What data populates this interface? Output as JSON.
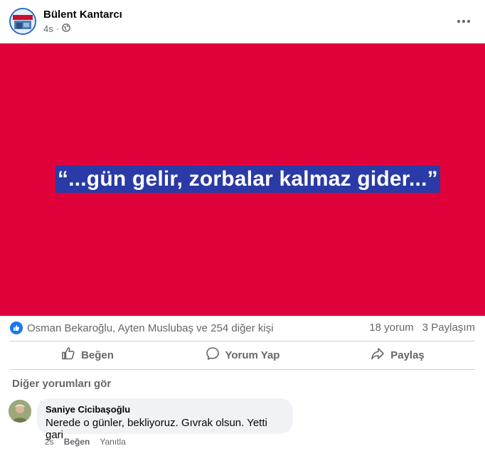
{
  "post": {
    "author": "Bülent Kantarcı",
    "time": "4s",
    "separator": "·",
    "quote": "“...gün gelir, zorbalar kalmaz gider...”",
    "banner_color": "#e0003a",
    "highlight_color": "#2a3aa6"
  },
  "reactions": {
    "summary": "Osman Bekaroğlu, Ayten Muslubaş ve 254 diğer kişi",
    "comments_count": "18 yorum",
    "shares_count": "3 Paylaşım"
  },
  "actions": {
    "like": "Beğen",
    "comment": "Yorum Yap",
    "share": "Paylaş"
  },
  "comments": {
    "see_more": "Diğer yorumları gör",
    "items": [
      {
        "name": "Saniye Cicibaşoğlu",
        "text": "Nerede o günler, bekliyoruz. Gıvrak olsun. Yetti gari",
        "time": "2s",
        "like": "Beğen",
        "reply": "Yanıtla"
      }
    ]
  },
  "icons": {
    "more": "more-horizontal-icon",
    "privacy": "globe-icon",
    "reaction": "like-reaction-icon",
    "like_action": "thumbs-up-icon",
    "comment_action": "comment-bubble-icon",
    "share_action": "share-arrow-icon"
  }
}
